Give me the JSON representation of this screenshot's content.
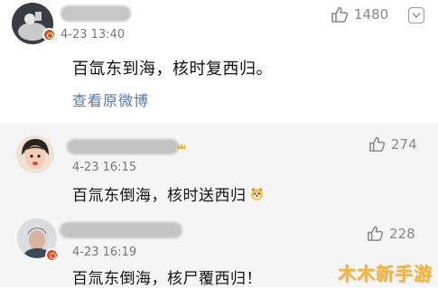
{
  "main_comment": {
    "time": "4-23 13:40",
    "likes": "1480",
    "text": "百氙东到海，核时复西归。",
    "view_original_label": "查看原微博"
  },
  "replies": [
    {
      "time": "4-23 16:15",
      "likes": "274",
      "text": "百氚东倒海，核时送西归"
    },
    {
      "time": "4-23 16:19",
      "likes": "228",
      "text": "百氚东倒海，核尸覆西归！"
    }
  ],
  "watermark": "木木新手游",
  "colors": {
    "link": "#5a79a8",
    "badge": "#e8491d",
    "reply_background": "#f5f5f5",
    "watermark": "#f4b73a"
  },
  "icons": [
    "thumbs-up-icon",
    "chevron-down-icon",
    "verified-badge-icon",
    "dog-emoji-icon"
  ]
}
